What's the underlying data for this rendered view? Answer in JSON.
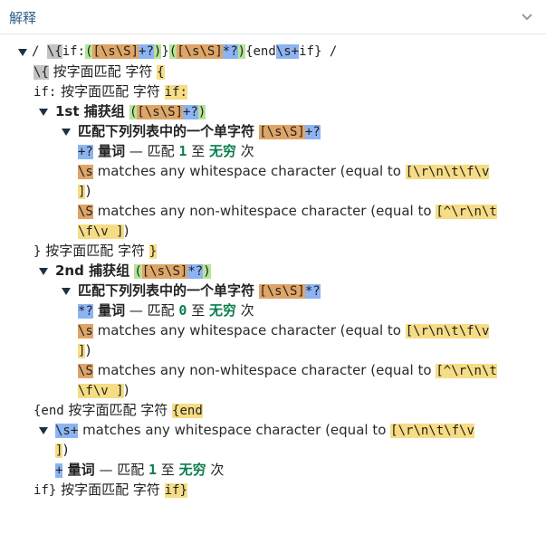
{
  "header": {
    "title": "解释"
  },
  "tree": {
    "root": {
      "p0": "/ ",
      "p1": "\\{",
      "p2": "if:",
      "p3": "(",
      "p4": "[\\s\\S]",
      "p5": "+?",
      "p6": ")",
      "p7": "}",
      "p8": "(",
      "p9": "[\\s\\S]",
      "p10": "*?",
      "p11": ")",
      "p12": "{end",
      "p13": "\\s+",
      "p14": "if}",
      "p15": " /"
    },
    "lit1": {
      "code": "\\{",
      "text": " 按字面匹配 字符 ",
      "val": "{"
    },
    "lit2": {
      "code": "if:",
      "text": " 按字面匹配 字符 ",
      "val": "if:"
    },
    "g1": {
      "label": "1st 捕获组 ",
      "o": "(",
      "cls": "[\\s\\S]",
      "q": "+?",
      "c": ")"
    },
    "g1set": {
      "label": "匹配下列列表中的一个单字符 ",
      "cls": "[\\s\\S]",
      "q": "+?"
    },
    "g1quant": {
      "q": "+?",
      "word": " 量词",
      "dash": " — 匹配 ",
      "n1": "1",
      "to": " 至 ",
      "n2": "无穷",
      "tail": " 次"
    },
    "s1": {
      "code": "\\s",
      "text": " matches any whitespace character (equal to ",
      "set": "[\\r\\n\\t\\f\\v",
      "set2": "]",
      "close": ")"
    },
    "S1": {
      "code": "\\S",
      "text": " matches any non-whitespace character (equal to ",
      "set": "[^\\r\\n\\t",
      "set2": "\\f\\v ]",
      "close": ")"
    },
    "lit3": {
      "code": "}",
      "text": " 按字面匹配 字符 ",
      "val": "}"
    },
    "g2": {
      "label": "2nd 捕获组 ",
      "o": "(",
      "cls": "[\\s\\S]",
      "q": "*?",
      "c": ")"
    },
    "g2set": {
      "label": "匹配下列列表中的一个单字符 ",
      "cls": "[\\s\\S]",
      "q": "*?"
    },
    "g2quant": {
      "q": "*?",
      "word": " 量词",
      "dash": " — 匹配 ",
      "n1": "0",
      "to": " 至 ",
      "n2": "无穷",
      "tail": " 次"
    },
    "s2": {
      "code": "\\s",
      "text": " matches any whitespace character (equal to ",
      "set": "[\\r\\n\\t\\f\\v",
      "set2": "]",
      "close": ")"
    },
    "S2": {
      "code": "\\S",
      "text": " matches any non-whitespace character (equal to ",
      "set": "[^\\r\\n\\t",
      "set2": "\\f\\v ]",
      "close": ")"
    },
    "lit4": {
      "code": "{end",
      "text": " 按字面匹配 字符 ",
      "val": "{end"
    },
    "s3": {
      "code": "\\s+",
      "text": " matches any whitespace character (equal to ",
      "set": "[\\r\\n\\t\\f\\v",
      "set2": "]",
      "close": ")"
    },
    "s3quant": {
      "q": "+",
      "word": " 量词",
      "dash": " — 匹配 ",
      "n1": "1",
      "to": " 至 ",
      "n2": "无穷",
      "tail": " 次"
    },
    "lit5": {
      "code": "if}",
      "text": " 按字面匹配 字符 ",
      "val": "if}"
    }
  },
  "colors": {
    "gray": "#c3c3c3",
    "green": "#b5e496",
    "blue": "#8db4f2",
    "orange": "#dfa566",
    "yellow": "#f6dd85",
    "number": "#0a7e4a",
    "title": "#2f5f86"
  },
  "icons": {
    "collapse": "chevron-down-icon",
    "expand": "triangle-down-icon"
  }
}
